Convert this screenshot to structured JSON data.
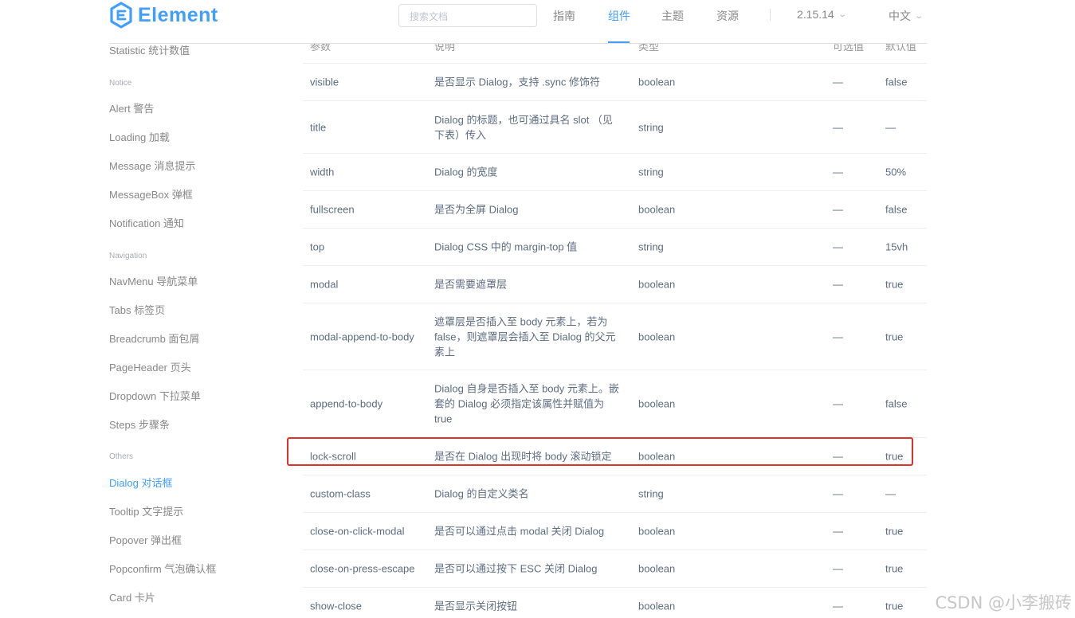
{
  "header": {
    "logo_text": "Element",
    "search_placeholder": "搜索文档",
    "nav": [
      "指南",
      "组件",
      "主题",
      "资源"
    ],
    "version": "2.15.14",
    "language": "中文"
  },
  "sidebar": {
    "items": [
      {
        "type": "item",
        "label": "Statistic 统计数值"
      },
      {
        "type": "group",
        "label": "Notice"
      },
      {
        "type": "item",
        "label": "Alert 警告"
      },
      {
        "type": "item",
        "label": "Loading 加载"
      },
      {
        "type": "item",
        "label": "Message 消息提示"
      },
      {
        "type": "item",
        "label": "MessageBox 弹框"
      },
      {
        "type": "item",
        "label": "Notification 通知"
      },
      {
        "type": "group",
        "label": "Navigation"
      },
      {
        "type": "item",
        "label": "NavMenu 导航菜单"
      },
      {
        "type": "item",
        "label": "Tabs 标签页"
      },
      {
        "type": "item",
        "label": "Breadcrumb 面包屑"
      },
      {
        "type": "item",
        "label": "PageHeader 页头"
      },
      {
        "type": "item",
        "label": "Dropdown 下拉菜单"
      },
      {
        "type": "item",
        "label": "Steps 步骤条"
      },
      {
        "type": "group",
        "label": "Others"
      },
      {
        "type": "item",
        "label": "Dialog 对话框"
      },
      {
        "type": "item",
        "label": "Tooltip 文字提示"
      },
      {
        "type": "item",
        "label": "Popover 弹出框"
      },
      {
        "type": "item",
        "label": "Popconfirm 气泡确认框"
      },
      {
        "type": "item",
        "label": "Card 卡片"
      }
    ]
  },
  "table": {
    "headers": [
      "参数",
      "说明",
      "类型",
      "可选值",
      "默认值"
    ],
    "rows": [
      [
        "visible",
        "是否显示 Dialog，支持 .sync 修饰符",
        "boolean",
        "—",
        "false"
      ],
      [
        "title",
        "Dialog 的标题，也可通过具名 slot （见下表）传入",
        "string",
        "—",
        "—"
      ],
      [
        "width",
        "Dialog 的宽度",
        "string",
        "—",
        "50%"
      ],
      [
        "fullscreen",
        "是否为全屏 Dialog",
        "boolean",
        "—",
        "false"
      ],
      [
        "top",
        "Dialog CSS 中的 margin-top 值",
        "string",
        "—",
        "15vh"
      ],
      [
        "modal",
        "是否需要遮罩层",
        "boolean",
        "—",
        "true"
      ],
      [
        "modal-append-to-body",
        "遮罩层是否插入至 body 元素上，若为 false，则遮罩层会插入至 Dialog 的父元素上",
        "boolean",
        "—",
        "true"
      ],
      [
        "append-to-body",
        "Dialog 自身是否插入至 body 元素上。嵌套的 Dialog 必须指定该属性并赋值为 true",
        "boolean",
        "—",
        "false"
      ],
      [
        "lock-scroll",
        "是否在 Dialog 出现时将 body 滚动锁定",
        "boolean",
        "—",
        "true"
      ],
      [
        "custom-class",
        "Dialog 的自定义类名",
        "string",
        "—",
        "—"
      ],
      [
        "close-on-click-modal",
        "是否可以通过点击 modal 关闭 Dialog",
        "boolean",
        "—",
        "true"
      ],
      [
        "close-on-press-escape",
        "是否可以通过按下 ESC 关闭 Dialog",
        "boolean",
        "—",
        "true"
      ],
      [
        "show-close",
        "是否显示关闭按钮",
        "boolean",
        "—",
        "true"
      ]
    ]
  },
  "watermark": "CSDN @小李搬砖",
  "colors": {
    "accent": "#409eff",
    "highlight": "#e0312b"
  }
}
